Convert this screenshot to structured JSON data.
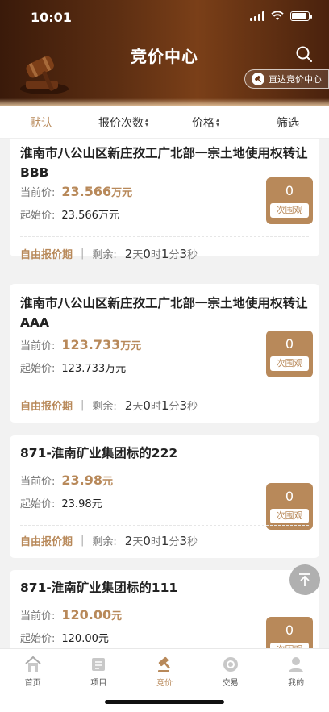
{
  "status_bar": {
    "time": "10:01"
  },
  "header": {
    "title": "竞价中心",
    "direct_button": "直达竞价中心"
  },
  "filters": [
    {
      "label": "默认",
      "active": true,
      "sortable": false
    },
    {
      "label": "报价次数",
      "active": false,
      "sortable": true
    },
    {
      "label": "价格",
      "active": false,
      "sortable": true
    },
    {
      "label": "筛选",
      "active": false,
      "sortable": false
    }
  ],
  "labels": {
    "current_price": "当前价:",
    "start_price": "起始价:",
    "watch_unit": "次围观",
    "remaining": "剩余:",
    "unit_day": "天",
    "unit_hour": "时",
    "unit_min": "分",
    "unit_sec": "秒",
    "separator": "|"
  },
  "items": [
    {
      "title": "淮南市八公山区新庄孜工广北部一宗土地使用权转让BBB",
      "current_price": "23.566",
      "current_unit": "万元",
      "start_price": "23.566万元",
      "watch_count": "0",
      "period": "自由报价期",
      "days": "2",
      "hours": "0",
      "mins": "1",
      "secs": "3"
    },
    {
      "title": "淮南市八公山区新庄孜工广北部一宗土地使用权转让AAA",
      "current_price": "123.733",
      "current_unit": "万元",
      "start_price": "123.733万元",
      "watch_count": "0",
      "period": "自由报价期",
      "days": "2",
      "hours": "0",
      "mins": "1",
      "secs": "3"
    },
    {
      "title": "871-淮南矿业集团标的222",
      "current_price": "23.98",
      "current_unit": "元",
      "start_price": "23.98元",
      "watch_count": "0",
      "period": "自由报价期",
      "days": "2",
      "hours": "0",
      "mins": "1",
      "secs": "3"
    },
    {
      "title": "871-淮南矿业集团标的111",
      "current_price": "120.00",
      "current_unit": "元",
      "start_price": "120.00元",
      "watch_count": "0"
    }
  ],
  "tabbar": [
    {
      "label": "首页",
      "icon": "home-icon",
      "active": false
    },
    {
      "label": "项目",
      "icon": "project-icon",
      "active": false
    },
    {
      "label": "竞价",
      "icon": "gavel-icon",
      "active": true
    },
    {
      "label": "交易",
      "icon": "trade-icon",
      "active": false
    },
    {
      "label": "我的",
      "icon": "user-icon",
      "active": false
    }
  ],
  "colors": {
    "accent": "#b8895a",
    "header_dark": "#3a1a0a"
  }
}
